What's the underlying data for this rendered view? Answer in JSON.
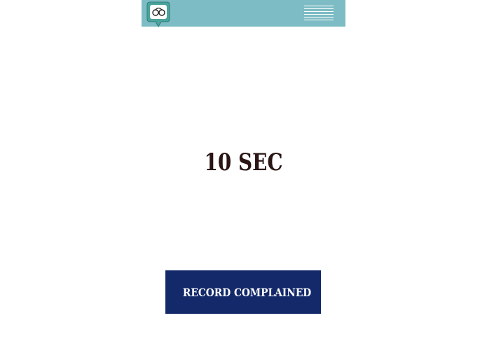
{
  "header": {
    "logo_icon": "handcuffs-pin-icon",
    "menu_icon": "hamburger-menu-icon",
    "background_color": "#7dbcc4"
  },
  "main": {
    "timer_text": "10 SEC",
    "timer_color": "#2a1414"
  },
  "actions": {
    "record_label": "RECORD COMPLAINED",
    "record_color": "#13296a"
  }
}
